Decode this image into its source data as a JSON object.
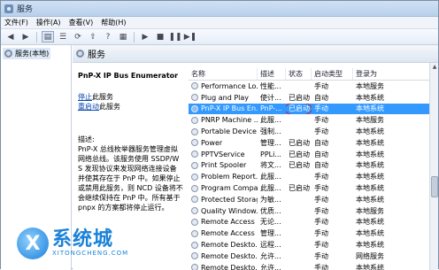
{
  "window": {
    "title": "服务"
  },
  "menu": [
    "文件(F)",
    "操作(A)",
    "查看(V)",
    "帮助(H)"
  ],
  "toolbar_icons": [
    "back-icon",
    "forward-icon",
    "console-tree-icon",
    "list-icon",
    "refresh-icon",
    "export-icon",
    "help-icon",
    "properties-icon",
    "play-icon",
    "stop-icon",
    "pause-icon",
    "restart-icon"
  ],
  "tree": {
    "item": "服务(本地)"
  },
  "pane": {
    "title": "服务"
  },
  "detail": {
    "service_name": "PnP-X IP Bus Enumerator",
    "stop_link": "停止",
    "stop_suffix": "此服务",
    "restart_link": "重启动",
    "restart_suffix": "此服务",
    "desc_label": "描述:",
    "description": "PnP-X 总线枚举器服务管理虚拟网络总线。该服务使用 SSDP/WS 发现协议来发现网络连接设备并使其存在于 PnP 中。如果停止或禁用此服务，则 NCD 设备将不会继续保持在 PnP 中。所有基于 pnpx 的方案都将停止运行。"
  },
  "list": {
    "columns": [
      "名称",
      "描述",
      "状态",
      "启动类型",
      "登录为"
    ],
    "rows": [
      {
        "name": "Performance Lo...",
        "desc": "性能...",
        "status": "",
        "startup": "手动",
        "logon": "本地服务"
      },
      {
        "name": "Plug and Play",
        "desc": "使计...",
        "status": "已启动",
        "startup": "自动",
        "logon": "本地系统"
      },
      {
        "name": "PnP-X IP Bus En...",
        "desc": "PnP-...",
        "status": "已启动",
        "startup": "手动",
        "logon": "本地系统",
        "selected": true
      },
      {
        "name": "PNRP Machine ...",
        "desc": "此服...",
        "status": "",
        "startup": "手动",
        "logon": "本地服务"
      },
      {
        "name": "Portable Device ...",
        "desc": "强制...",
        "status": "",
        "startup": "手动",
        "logon": "本地系统"
      },
      {
        "name": "Power",
        "desc": "管理...",
        "status": "已启动",
        "startup": "自动",
        "logon": "本地系统"
      },
      {
        "name": "PPTVService",
        "desc": "PPLi...",
        "status": "已启动",
        "startup": "自动",
        "logon": "本地系统"
      },
      {
        "name": "Print Spooler",
        "desc": "将文...",
        "status": "已启动",
        "startup": "自动",
        "logon": "本地系统"
      },
      {
        "name": "Problem Report...",
        "desc": "此服...",
        "status": "",
        "startup": "手动",
        "logon": "本地系统"
      },
      {
        "name": "Program Compa...",
        "desc": "此服...",
        "status": "已启动",
        "startup": "手动",
        "logon": "本地系统"
      },
      {
        "name": "Protected Storage",
        "desc": "为敏...",
        "status": "",
        "startup": "手动",
        "logon": "本地系统"
      },
      {
        "name": "Quality Window...",
        "desc": "优质...",
        "status": "",
        "startup": "手动",
        "logon": "本地服务"
      },
      {
        "name": "Remote Access ...",
        "desc": "无论...",
        "status": "",
        "startup": "手动",
        "logon": "本地系统"
      },
      {
        "name": "Remote Access ...",
        "desc": "管理...",
        "status": "",
        "startup": "手动",
        "logon": "本地系统"
      },
      {
        "name": "Remote Deskto...",
        "desc": "远程...",
        "status": "",
        "startup": "手动",
        "logon": "本地系统"
      },
      {
        "name": "Remote Deskto...",
        "desc": "允许...",
        "status": "",
        "startup": "手动",
        "logon": "网络服务"
      },
      {
        "name": "Remote Deskto...",
        "desc": "允许...",
        "status": "",
        "startup": "手动",
        "logon": "本地系统"
      }
    ]
  },
  "watermark": {
    "logo_letter": "X",
    "text": "系统城",
    "url": "XITONGCHENG.COM"
  }
}
